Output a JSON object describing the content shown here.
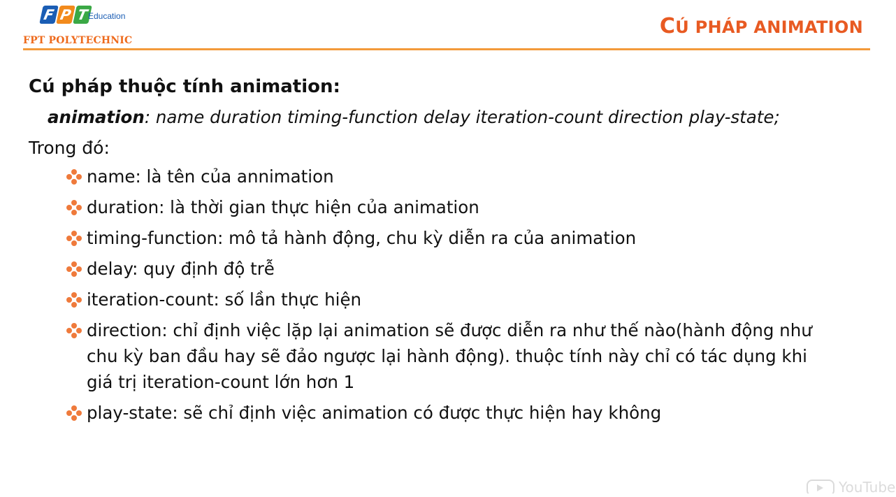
{
  "header": {
    "logo": {
      "letters": [
        "F",
        "P",
        "T"
      ],
      "education": "Education",
      "school": "FPT POLYTECHNIC"
    },
    "title_first": "C",
    "title_rest": "Ú PHÁP ANIMATION",
    "colors": {
      "accent": "#e85a22",
      "rule": "#f39a3a"
    }
  },
  "content": {
    "heading": "Cú pháp thuộc tính animation:",
    "syntax": {
      "keyword": "animation",
      "rest": ": name duration timing-function delay iteration-count direction play-state;"
    },
    "where": "Trong đó:",
    "bullet_icon": "diamond-dots-bullet",
    "items": [
      "name: là tên của annimation",
      "duration: là thời gian thực hiện của animation",
      "timing-function:  mô tả hành động, chu kỳ diễn ra của animation",
      "delay: quy định độ trễ",
      "iteration-count: số lần thực hiện",
      "direction: chỉ định việc lặp lại animation sẽ được diễn ra như thế nào(hành động như chu kỳ ban đầu hay sẽ đảo ngược lại hành động). thuộc tính này chỉ có tác dụng khi giá trị iteration-count lớn hơn 1",
      "play-state: sẽ chỉ định việc animation có được thực hiện hay không"
    ]
  },
  "watermark": {
    "text": "YouTube",
    "icon": "youtube-icon"
  }
}
